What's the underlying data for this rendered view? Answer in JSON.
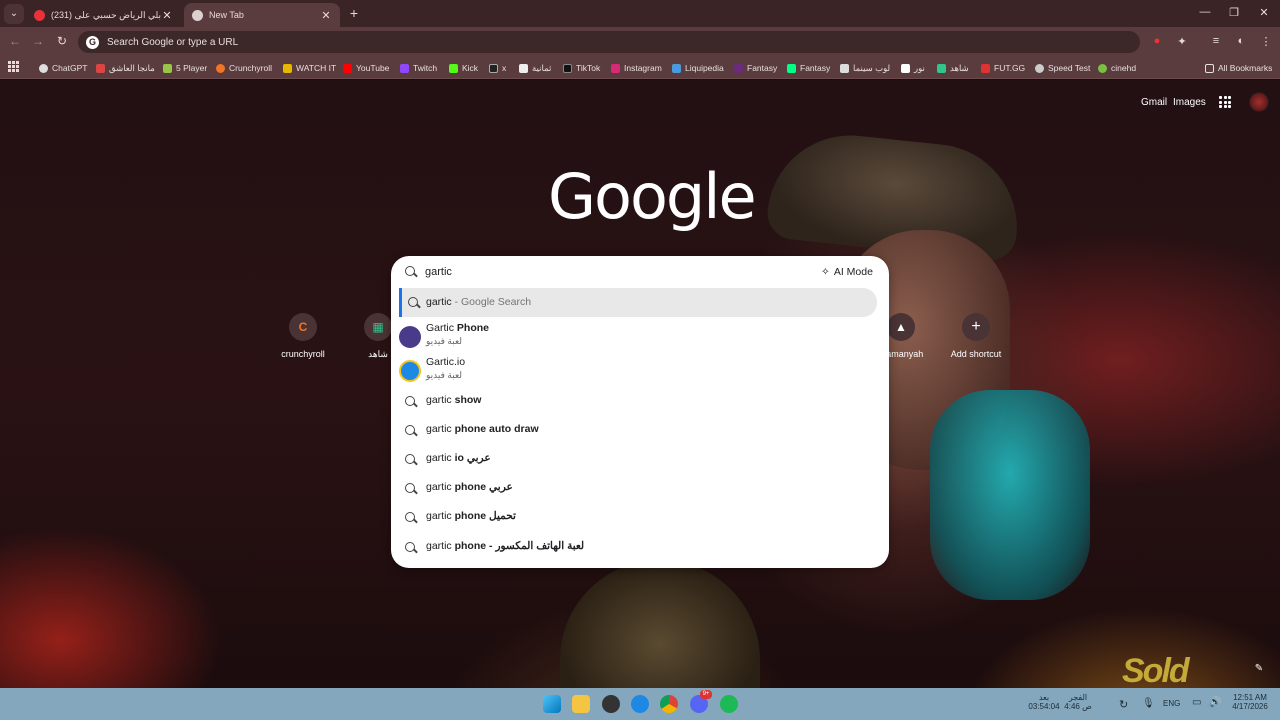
{
  "tabs": [
    {
      "title": "(231) دبلي الرياض حسبي على...",
      "favicon_color": "#e8313a"
    },
    {
      "title": "New Tab",
      "favicon_color": "#dcd0d0"
    }
  ],
  "omnibox": {
    "placeholder": "Search Google or type a URL"
  },
  "bookmarks": [
    {
      "label": "ChatGPT",
      "color": "#dedede"
    },
    {
      "label": "مانجا العاشق",
      "color": "#d44"
    },
    {
      "label": "5 Player",
      "color": "#9ac34a"
    },
    {
      "label": "Crunchyroll",
      "color": "#f47521"
    },
    {
      "label": "WATCH IT",
      "color": "#e6b800"
    },
    {
      "label": "YouTube",
      "color": "#ff0000"
    },
    {
      "label": "Twitch",
      "color": "#9146ff"
    },
    {
      "label": "Kick",
      "color": "#53fc18"
    },
    {
      "label": "x",
      "color": "#222222"
    },
    {
      "label": "ثمانية",
      "color": "#eeeeee"
    },
    {
      "label": "TikTok",
      "color": "#111111"
    },
    {
      "label": "Instagram",
      "color": "#d62976"
    },
    {
      "label": "Liquipedia",
      "color": "#4b9ae0"
    },
    {
      "label": "Fantasy",
      "color": "#6b2a7a"
    },
    {
      "label": "Fantasy",
      "color": "#00ff85"
    },
    {
      "label": "لوب سينما",
      "color": "#dddddd"
    },
    {
      "label": "نور",
      "color": "#ffffff"
    },
    {
      "label": "شاهد",
      "color": "#32c48d"
    },
    {
      "label": "FUT.GG",
      "color": "#d33"
    },
    {
      "label": "Speed Test",
      "color": "#ccc"
    },
    {
      "label": "cinehd",
      "color": "#7ac142"
    }
  ],
  "all_bookmarks": "All Bookmarks",
  "header": {
    "gmail": "Gmail",
    "images": "Images"
  },
  "logo": "Google",
  "shortcuts": [
    {
      "label": "crunchyroll",
      "icon": "C"
    },
    {
      "label": "شاهد",
      "icon": "▦"
    },
    {
      "label": "thamanyah",
      "icon": "▲"
    },
    {
      "label": "Add shortcut",
      "icon": "+"
    }
  ],
  "search": {
    "query": "gartic",
    "ai_mode": "AI Mode",
    "suggestions": [
      {
        "prefix": "gartic",
        "rest": " - Google Search",
        "type": "search",
        "selected": true
      },
      {
        "prefix": "Gartic",
        "rest": " Phone",
        "sub": "لعبة فيديو",
        "type": "entity",
        "icon_color": "#4a3a8a"
      },
      {
        "prefix": "Gartic.io",
        "rest": "",
        "sub": "لعبة فيديو",
        "type": "entity",
        "icon_color": "#1e88e5"
      },
      {
        "prefix": "gartic",
        "rest": " show",
        "type": "search"
      },
      {
        "prefix": "gartic",
        "rest": " phone auto draw",
        "type": "search"
      },
      {
        "prefix": "gartic",
        "rest": " io عربي",
        "type": "search"
      },
      {
        "prefix": "gartic",
        "rest": " phone عربي",
        "type": "search"
      },
      {
        "prefix": "gartic",
        "rest": " phone تحميل",
        "type": "search"
      },
      {
        "prefix": "gartic",
        "rest": " phone - لعبة الهاتف المكسور",
        "type": "search"
      }
    ]
  },
  "taskbar": {
    "prayer1": "بعد",
    "prayer1_time": "03:54:04",
    "prayer2": "الفجر",
    "prayer2_time": "4:46 ص",
    "lang": "ENG",
    "time": "12:51 AM",
    "date": "4/17/2026",
    "discord_badge": "9+"
  },
  "wallpaper_text": "Sold"
}
